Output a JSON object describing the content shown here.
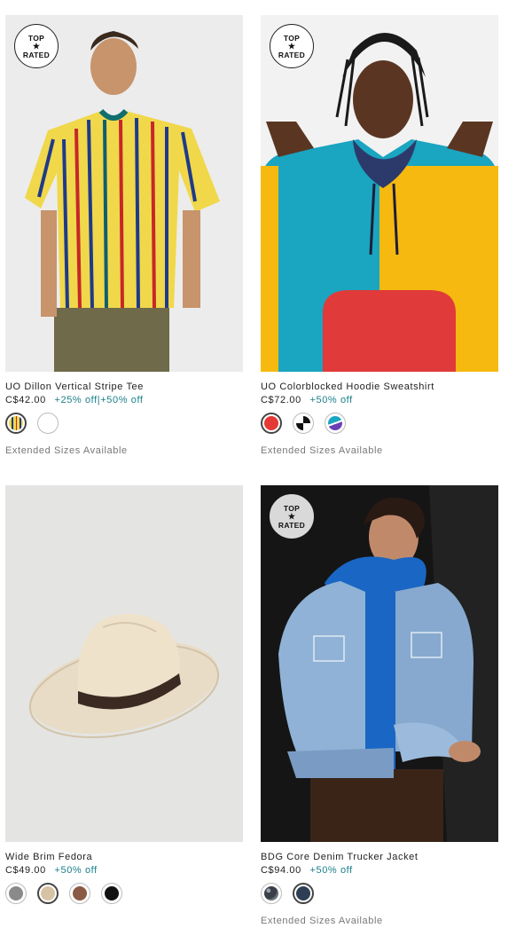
{
  "products": [
    {
      "name": "UO Dillon Vertical Stripe Tee",
      "price": "C$42.00",
      "promo": "+25% off|+50% off",
      "badge": {
        "line1": "TOP",
        "star": "★",
        "line2": "RATED"
      },
      "extended": "Extended Sizes Available",
      "swatch_colors": [
        "stripe-yellow-blue",
        "#ffffff"
      ],
      "image": "person-wearing-yellow-vertical-stripe-tee"
    },
    {
      "name": "UO Colorblocked Hoodie Sweatshirt",
      "price": "C$72.00",
      "promo": "+50% off",
      "badge": {
        "line1": "TOP",
        "star": "★",
        "line2": "RATED"
      },
      "extended": "Extended Sizes Available",
      "swatch_colors": [
        "#e53935",
        "black-white-pattern",
        "teal-purple-pattern"
      ],
      "image": "person-wearing-colorblocked-hoodie"
    },
    {
      "name": "Wide Brim Fedora",
      "price": "C$49.00",
      "promo": "+50% off",
      "swatch_colors": [
        "#8a8a8a",
        "#d8c2a4",
        "#8a5a44",
        "#111111"
      ],
      "image": "cream-wide-brim-fedora"
    },
    {
      "name": "BDG Core Denim Trucker Jacket",
      "price": "C$94.00",
      "promo": "+50% off",
      "badge": {
        "line1": "TOP",
        "star": "★",
        "line2": "RATED"
      },
      "extended": "Extended Sizes Available",
      "swatch_colors": [
        "#3a3f4a",
        "#7f97b8"
      ],
      "image": "person-wearing-light-denim-jacket-blue-hoodie"
    }
  ]
}
